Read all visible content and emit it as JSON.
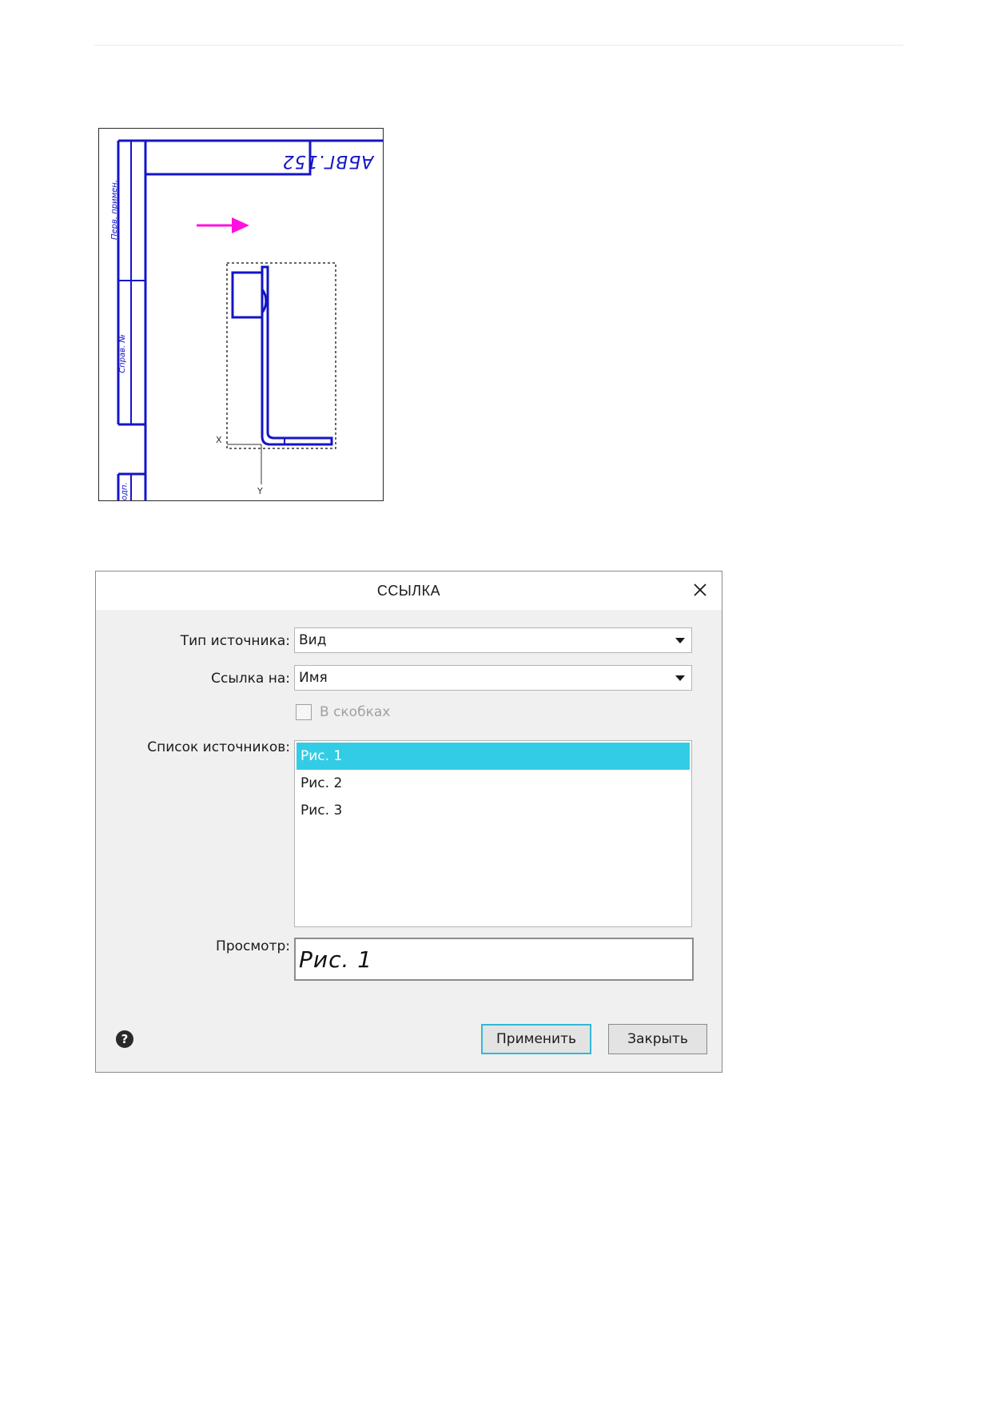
{
  "drawing": {
    "stamp_text": "АБВГ.152",
    "side_labels": [
      "Перв. примен.",
      "Справ. №",
      "Подп."
    ]
  },
  "dialog": {
    "title": "ССЫЛКА",
    "source_type": {
      "label": "Тип источника:",
      "value": "Вид"
    },
    "reference_to": {
      "label": "Ссылка на:",
      "value": "Имя"
    },
    "in_brackets": {
      "label": "В скобках",
      "checked": false
    },
    "sources": {
      "label": "Список источников:",
      "items": [
        "Рис. 1",
        "Рис. 2",
        "Рис. 3"
      ],
      "selected_index": 0
    },
    "preview": {
      "label": "Просмотр:",
      "value": "Рис. 1"
    },
    "buttons": {
      "apply": "Применить",
      "close": "Закрыть"
    },
    "colors": {
      "selection": "#33cce6",
      "drawing_line": "#1414c8",
      "arrow": "#ff10e0"
    },
    "icons": {
      "close": "close-icon",
      "help": "help-icon",
      "dropdown": "chevron-down-icon"
    }
  }
}
